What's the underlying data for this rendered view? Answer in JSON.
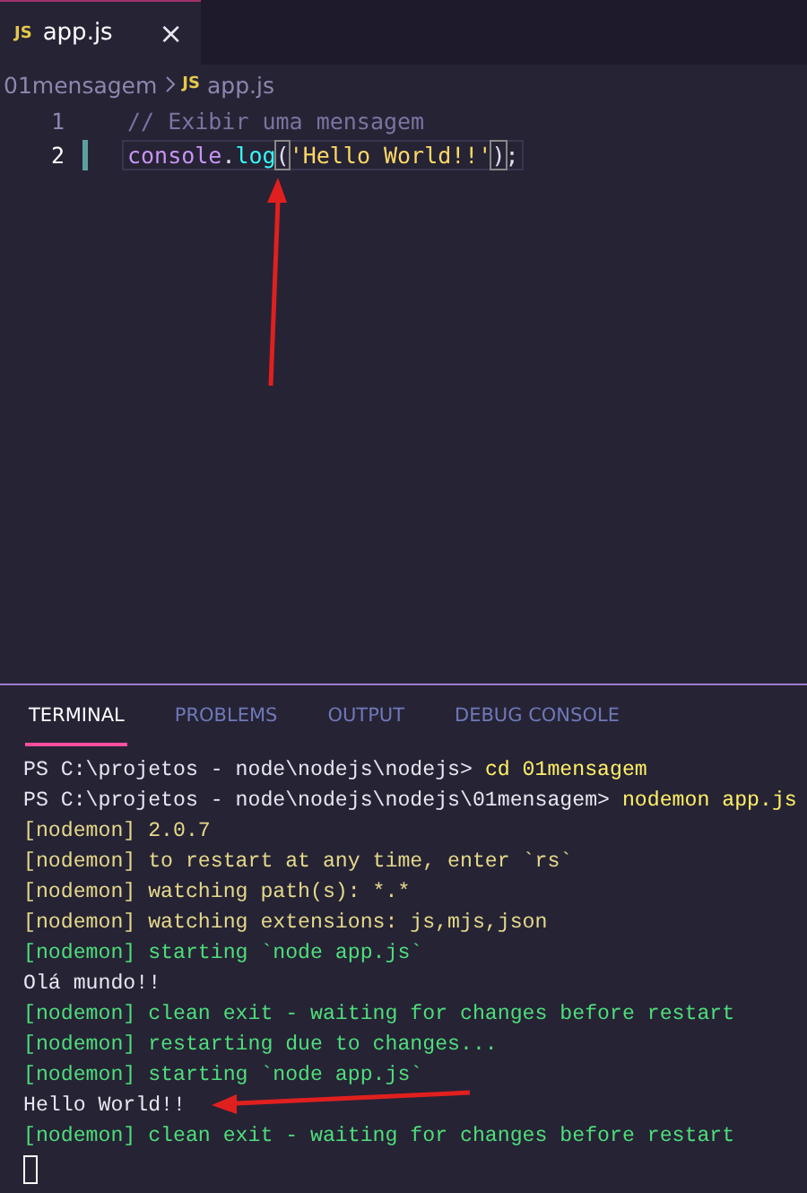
{
  "editor_tabs": [
    {
      "icon": "JS",
      "label": "app.js",
      "close": "×",
      "selected": true
    }
  ],
  "breadcrumb": [
    {
      "label": "01mensagem"
    },
    {
      "icon": "JS",
      "label": "app.js"
    }
  ],
  "code_lines": [
    {
      "number": "1",
      "current": false,
      "tokens": [
        {
          "kind": "comment",
          "text": "// Exibir uma mensagem"
        }
      ]
    },
    {
      "number": "2",
      "current": true,
      "tokens": [
        {
          "kind": "variable",
          "text": "console"
        },
        {
          "kind": "punct",
          "text": "."
        },
        {
          "kind": "function",
          "text": "log"
        },
        {
          "kind": "bracket",
          "text": "("
        },
        {
          "kind": "string",
          "text": "'Hello World!!'"
        },
        {
          "kind": "bracket",
          "text": ")"
        },
        {
          "kind": "punct",
          "text": ";"
        }
      ]
    }
  ],
  "panel_tabs": [
    {
      "label": "TERMINAL",
      "selected": true
    },
    {
      "label": "PROBLEMS",
      "selected": false
    },
    {
      "label": "OUTPUT",
      "selected": false
    },
    {
      "label": "DEBUG CONSOLE",
      "selected": false
    }
  ],
  "terminal_lines": [
    {
      "kind": "prompt",
      "prompt": "PS C:\\projetos - node\\nodejs\\nodejs>",
      "command": "cd 01mensagem"
    },
    {
      "kind": "prompt",
      "prompt": "PS C:\\projetos - node\\nodejs\\nodejs\\01mensagem>",
      "command": "nodemon app.js"
    },
    {
      "kind": "info",
      "text": "[nodemon] 2.0.7"
    },
    {
      "kind": "info",
      "text": "[nodemon] to restart at any time, enter `rs`"
    },
    {
      "kind": "info",
      "text": "[nodemon] watching path(s): *.*"
    },
    {
      "kind": "info",
      "text": "[nodemon] watching extensions: js,mjs,json"
    },
    {
      "kind": "status",
      "text": "[nodemon] starting `node app.js`"
    },
    {
      "kind": "output",
      "text": "Olá mundo!!"
    },
    {
      "kind": "status",
      "text": "[nodemon] clean exit - waiting for changes before restart"
    },
    {
      "kind": "status",
      "text": "[nodemon] restarting due to changes..."
    },
    {
      "kind": "status",
      "text": "[nodemon] starting `node app.js`"
    },
    {
      "kind": "output",
      "text": "Hello World!!"
    },
    {
      "kind": "status",
      "text": "[nodemon] clean exit - waiting for changes before restart"
    }
  ]
}
